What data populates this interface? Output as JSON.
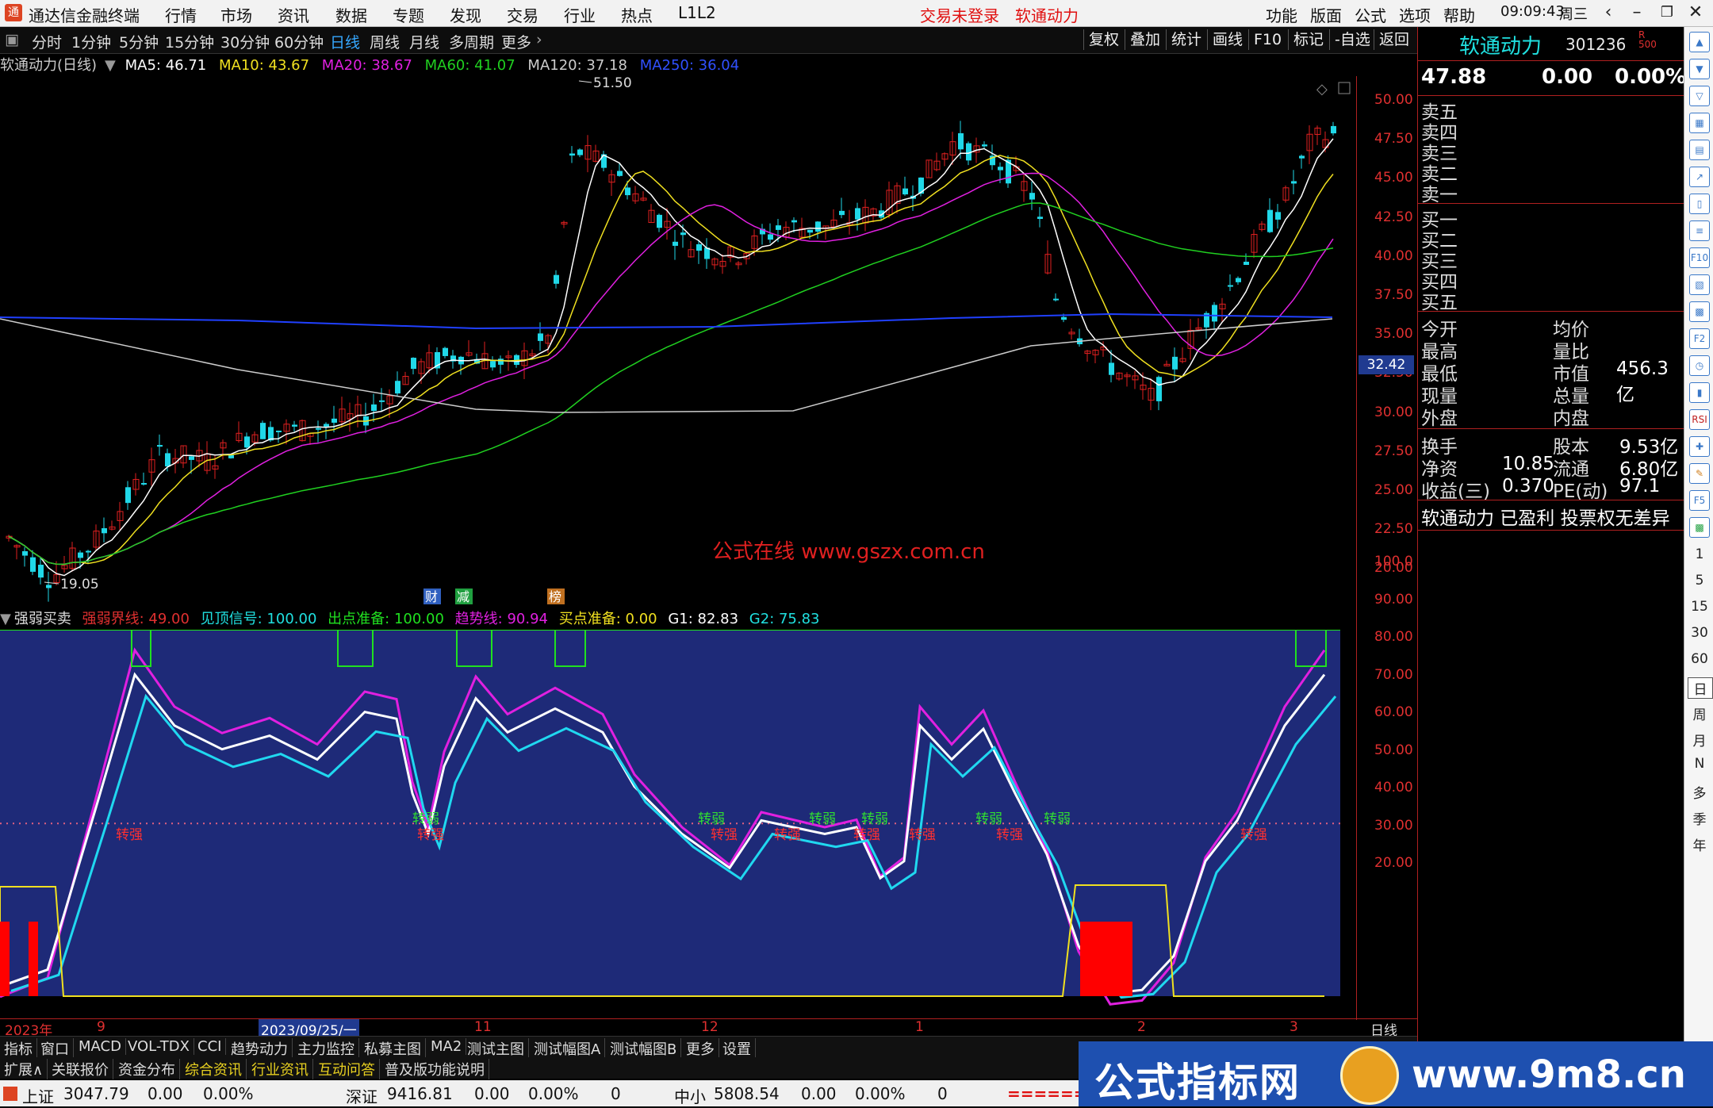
{
  "app": {
    "title": "通达信金融终端",
    "menu": [
      "行情",
      "市场",
      "资讯",
      "数据",
      "专题",
      "发现",
      "交易",
      "行业",
      "热点",
      "L1L2"
    ],
    "status_red": [
      "交易未登录",
      "软通动力"
    ],
    "right_menu": [
      "功能",
      "版面",
      "公式",
      "选项",
      "帮助"
    ],
    "clock": "09:09:43",
    "weekday": "周三"
  },
  "toolbar": {
    "periods": [
      "分时",
      "1分钟",
      "5分钟",
      "15分钟",
      "30分钟",
      "60分钟",
      "日线",
      "周线",
      "月线",
      "多周期",
      "更多"
    ],
    "active": "日线",
    "right_buttons": [
      "复权",
      "叠加",
      "统计",
      "画线",
      "F10",
      "标记",
      "-自选",
      "返回"
    ]
  },
  "ma_legend": {
    "name": "软通动力(日线)",
    "items": [
      {
        "label": "MA5: 46.71",
        "color": "#ffffff"
      },
      {
        "label": "MA10: 43.67",
        "color": "#f0e020"
      },
      {
        "label": "MA20: 38.67",
        "color": "#e020e0"
      },
      {
        "label": "MA60: 41.07",
        "color": "#20d020"
      },
      {
        "label": "MA120: 37.18",
        "color": "#cccccc"
      },
      {
        "label": "MA250: 36.04",
        "color": "#2040ff"
      }
    ]
  },
  "main_chart": {
    "price_ticks": [
      "50.00",
      "47.50",
      "45.00",
      "42.50",
      "40.00",
      "37.50",
      "35.00",
      "32.50",
      "30.00",
      "27.50",
      "25.00",
      "22.50",
      "20.00"
    ],
    "high_label": "51.50",
    "low_label": "19.05",
    "current_price_tag": "32.42",
    "watermark": "公式在线  www.gszx.com.cn",
    "event_tags": [
      "财",
      "减",
      "榜"
    ]
  },
  "sub_indicator": {
    "name": "强弱买卖",
    "items": [
      {
        "label": "强弱界线: 49.00",
        "color": "#e03030"
      },
      {
        "label": "见顶信号: 100.00",
        "color": "#20e0e0"
      },
      {
        "label": "出点准备: 100.00",
        "color": "#20e020"
      },
      {
        "label": "趋势线: 90.94",
        "color": "#e020e0"
      },
      {
        "label": "买点准备: 0.00",
        "color": "#f0e020"
      },
      {
        "label": "G1: 82.83",
        "color": "#ffffff"
      },
      {
        "label": "G2: 75.83",
        "color": "#20e0e0"
      }
    ],
    "ticks": [
      "100.0",
      "90.00",
      "80.00",
      "70.00",
      "60.00",
      "50.00",
      "40.00",
      "30.00",
      "20.00"
    ],
    "strong_label": "转强",
    "weak_label": "转弱"
  },
  "time_axis": {
    "labels": [
      "2023年",
      "9",
      "2023/09/25/一",
      "11",
      "12",
      "1",
      "2",
      "3"
    ],
    "period": "日线"
  },
  "tabs_row1": [
    "指标",
    "窗口",
    "MACD",
    "VOL-TDX",
    "CCI",
    "趋势动力",
    "主力监控",
    "私募主图",
    "MA2",
    "测试主图",
    "测试幅图A",
    "测试幅图B",
    "更多",
    "设置"
  ],
  "tabs_row2": [
    "扩展∧",
    "关联报价",
    "资金分布",
    "综合资讯",
    "行业资讯",
    "互动问答",
    "普及版功能说明"
  ],
  "quote_panel": {
    "name": "软通动力",
    "code": "301236",
    "price": "47.88",
    "change": "0.00",
    "pct": "0.00%",
    "sell": [
      "卖五",
      "卖四",
      "卖三",
      "卖二",
      "卖一"
    ],
    "buy": [
      "买一",
      "买二",
      "买三",
      "买四",
      "买五"
    ],
    "stats": [
      {
        "l": "今开",
        "lv": "",
        "r": "均价",
        "rv": ""
      },
      {
        "l": "最高",
        "lv": "",
        "r": "量比",
        "rv": ""
      },
      {
        "l": "最低",
        "lv": "",
        "r": "市值",
        "rv": "456.3亿"
      },
      {
        "l": "现量",
        "lv": "",
        "r": "总量",
        "rv": ""
      },
      {
        "l": "外盘",
        "lv": "",
        "r": "内盘",
        "rv": ""
      }
    ],
    "stats2": [
      {
        "l": "换手",
        "lv": "",
        "r": "股本",
        "rv": "9.53亿"
      },
      {
        "l": "净资",
        "lv": "10.85",
        "r": "流通",
        "rv": "6.80亿"
      },
      {
        "l": "收益(三)",
        "lv": "0.370",
        "r": "PE(动)",
        "rv": "97.1"
      }
    ],
    "note": "软通动力 已盈利 投票权无差异"
  },
  "sidebar": {
    "periods": [
      "1",
      "5",
      "15",
      "30",
      "60",
      "日",
      "周",
      "月",
      "N",
      "多",
      "季",
      "年"
    ]
  },
  "status_bar": [
    {
      "name": "上证",
      "val": "3047.79",
      "chg": "0.00",
      "pct": "0.00%",
      "vol": ""
    },
    {
      "name": "深证",
      "val": "9416.81",
      "chg": "0.00",
      "pct": "0.00%",
      "vol": "0"
    },
    {
      "name": "中小",
      "val": "5808.54",
      "chg": "0.00",
      "pct": "0.00%",
      "vol": "0"
    }
  ],
  "banner": {
    "left": "公式指标网",
    "right": "www.9m8.cn"
  }
}
